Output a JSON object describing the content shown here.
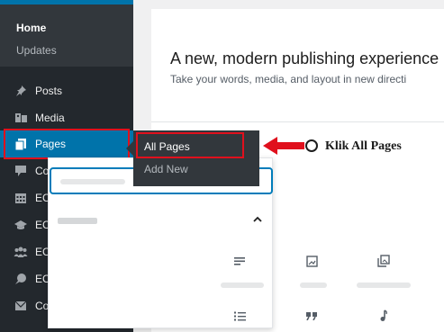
{
  "sidebar": {
    "home": "Home",
    "updates": "Updates",
    "items": [
      {
        "label": "Posts",
        "icon": "pin-icon"
      },
      {
        "label": "Media",
        "icon": "media-icon"
      },
      {
        "label": "Pages",
        "icon": "pages-icon",
        "active": true
      },
      {
        "label": "Comments",
        "icon": "comment-icon"
      },
      {
        "label": "EC Events",
        "icon": "calendar-icon"
      },
      {
        "label": "EC Courses",
        "icon": "graduation-cap-icon"
      },
      {
        "label": "EC Teams",
        "icon": "group-icon"
      },
      {
        "label": "EC Testimonials",
        "icon": "testimonial-icon"
      },
      {
        "label": "Contact",
        "icon": "envelope-icon"
      }
    ]
  },
  "submenu": {
    "items": [
      "All Pages",
      "Add New"
    ]
  },
  "main": {
    "headline": "A new, modern publishing experience",
    "subline": "Take your words, media, and layout in new directi"
  },
  "annotation": {
    "text": "Klik All Pages",
    "color": "#e0101d"
  },
  "colors": {
    "sidebar_bg": "#23282d",
    "active_bg": "#0073aa",
    "highlight": "#e0101d",
    "focus": "#007cba"
  }
}
